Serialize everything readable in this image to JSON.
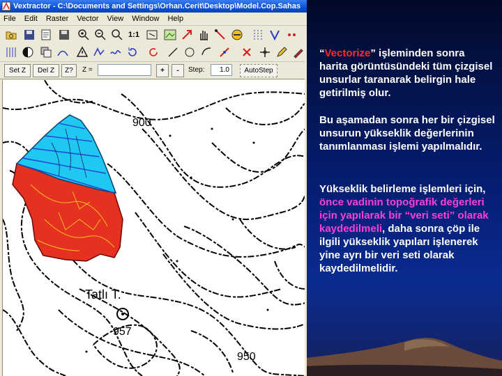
{
  "window": {
    "title": "Vextractor - C:\\Documents and Settings\\Orhan.Cerit\\Desktop\\Model.Cop.Sahas"
  },
  "menu": [
    "File",
    "Edit",
    "Raster",
    "Vector",
    "View",
    "Window",
    "Help"
  ],
  "toolbar1": {
    "zoom_label": "1:1"
  },
  "toolbar3": {
    "set_z": "Set Z",
    "del_z": "Del Z",
    "z_query": "Z?",
    "z_label": "Z =",
    "z_value": "",
    "plus": "+",
    "minus": "-",
    "step_label": "Step:",
    "step_value": "1.0",
    "auto_step": "AutoStep"
  },
  "map": {
    "labels": {
      "contour_900": "900",
      "peak_name": "Tatlı T.",
      "peak_height": "957",
      "contour_950": "950"
    },
    "colors": {
      "upper_fill": "#1ec8f0",
      "lower_fill": "#e63020",
      "vector_line": "#2a3fd8",
      "contour": "#000000"
    }
  },
  "slide": {
    "p1_quote_open": "“",
    "p1_keyword": "Vectorize",
    "p1_rest": "” işleminden sonra harita görüntüsündeki tüm çizgisel unsurlar taranarak belirgin hale getirilmiş olur.",
    "p2": "Bu aşamadan sonra her bir çizgisel unsurun yükseklik değerlerinin tanımlanması işlemi yapılmalıdır.",
    "p3_a": "Yükseklik belirleme işlemleri için, ",
    "p3_b": "önce vadinin topoğrafik değerleri için yapılarak bir ",
    "p3_c": "“veri seti” olarak kaydedilmeli",
    "p3_d": ", daha sonra çöp ile ilgili yükseklik yapıları işlenerek yine ayrı bir veri seti olarak kaydedilmelidir."
  }
}
